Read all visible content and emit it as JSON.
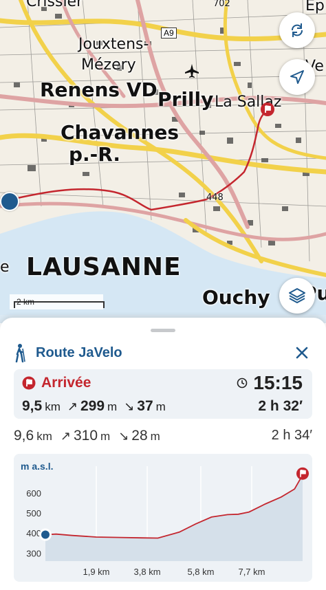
{
  "map": {
    "labels": {
      "lausanne": "LAUSANNE",
      "ouchy": "Ouchy",
      "renens": "Renens VD",
      "prilly": "Prilly",
      "la_sallaz": "La Sallaz",
      "chavannes": "Chavannes",
      "chavannes2": "p.-R.",
      "jouxtens": "Jouxtens-",
      "mezery": "Mézery",
      "road_a9": "A9",
      "alt_702": "702",
      "alt_448": "448",
      "crissier": "Crissier",
      "pully": "Pully",
      "edge_e": "e",
      "edge_ve": "Ve",
      "edge_ep": "Ep"
    },
    "scale_label": "2 km",
    "buttons": {
      "orientation_icon": "rotate-arrows-icon",
      "locate_icon": "navigation-arrow-icon",
      "layers_icon": "layers-icon"
    },
    "colors": {
      "water": "#d5e7f4",
      "route": "#c4262e",
      "road_yellow": "#f2d14a",
      "road_pink": "#dea3a3"
    }
  },
  "sheet": {
    "route_title": "Route JaVelo",
    "route_icon": "hiker-icon",
    "close_icon": "close-icon",
    "destination": {
      "label": "Arrivée",
      "time": "15:15",
      "distance": "9,5",
      "distance_unit": "km",
      "ascent": "299",
      "ascent_unit": "m",
      "descent": "37",
      "descent_unit": "m",
      "duration": "2 h 32′"
    },
    "total": {
      "distance": "9,6",
      "distance_unit": "km",
      "ascent": "310",
      "ascent_unit": "m",
      "descent": "28",
      "descent_unit": "m",
      "duration": "2 h 34′"
    },
    "profile": {
      "y_axis_label": "m a.s.l."
    }
  },
  "chart_data": {
    "type": "area",
    "ylabel": "m a.s.l.",
    "yticks": [
      300,
      400,
      500,
      600
    ],
    "xticks": [
      "1,9 km",
      "3,8 km",
      "5,8 km",
      "7,7 km"
    ],
    "x_km": [
      0,
      0.4,
      1.0,
      1.9,
      2.8,
      3.6,
      4.2,
      5.0,
      5.6,
      6.2,
      6.8,
      7.2,
      7.6,
      8.2,
      8.8,
      9.3,
      9.6
    ],
    "y_m": [
      392,
      395,
      388,
      380,
      378,
      376,
      375,
      405,
      445,
      480,
      492,
      494,
      505,
      545,
      580,
      620,
      690
    ],
    "xlim": [
      0,
      9.6
    ],
    "ylim": [
      260,
      720
    ],
    "grid": true,
    "colors": {
      "line": "#c4262e",
      "fill": "#d5e0ea"
    }
  }
}
